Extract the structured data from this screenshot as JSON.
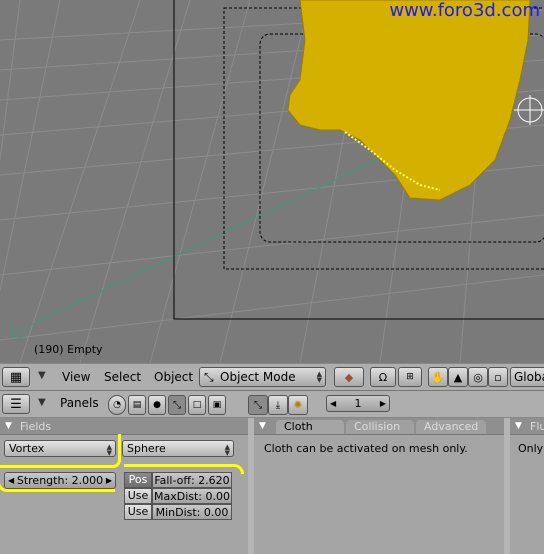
{
  "watermark": "www.foro3d.com",
  "viewport": {
    "status": "(190) Empty"
  },
  "header3d": {
    "menus": [
      "View",
      "Select",
      "Object"
    ],
    "mode": "Object Mode",
    "orientation": "Globa"
  },
  "buttons_header": {
    "panels_label": "Panels",
    "frame_value": "1"
  },
  "fields_panel": {
    "title": "Fields",
    "type": "Vortex",
    "shape": "Sphere",
    "strength": "Strength: 2.000",
    "pos_label": "Pos",
    "use1_label": "Use",
    "use2_label": "Use",
    "falloff": "Fall-off: 2.620",
    "maxdist": "MaxDist: 0.00",
    "mindist": "MinDist: 0.00"
  },
  "cloth_panel": {
    "tabs": [
      "Cloth",
      "Collision",
      "Advanced"
    ],
    "message": "Cloth can be activated on mesh only."
  },
  "right_panel": {
    "title": "Flu",
    "message": "Only r"
  },
  "colors": {
    "highlight": "#ffff00",
    "mesh": "#d4b000",
    "watermark": "#1a1aff"
  }
}
